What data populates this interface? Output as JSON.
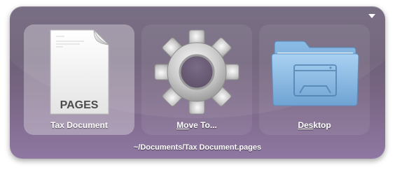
{
  "menu": {
    "icon": "dropdown-triangle-icon"
  },
  "items": [
    {
      "label": "Tax Document",
      "icon": "pages-document-icon",
      "doc_type": "PAGES",
      "selected": true
    },
    {
      "label_accel": "Mo",
      "label_rest": "ve To...",
      "icon": "gear-icon",
      "selected": false
    },
    {
      "label_accel": "Des",
      "label_rest": "ktop",
      "icon": "blue-folder-icon",
      "selected": false
    }
  ],
  "path": "~/Documents/Tax Document.pages",
  "colors": {
    "panel": "#6f637b",
    "folder": "#7fb0dc"
  }
}
